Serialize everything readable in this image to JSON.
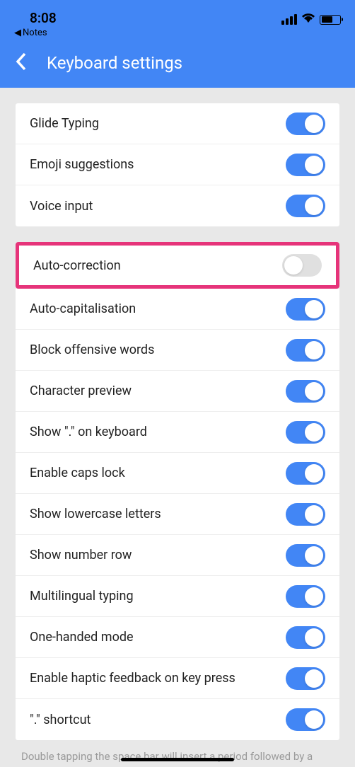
{
  "status": {
    "time": "8:08",
    "backApp": "Notes"
  },
  "header": {
    "title": "Keyboard settings"
  },
  "section1": [
    {
      "label": "Glide Typing",
      "on": true
    },
    {
      "label": "Emoji suggestions",
      "on": true
    },
    {
      "label": "Voice input",
      "on": true
    }
  ],
  "highlighted": {
    "label": "Auto-correction",
    "on": false
  },
  "section2": [
    {
      "label": "Auto-capitalisation",
      "on": true
    },
    {
      "label": "Block offensive words",
      "on": true
    },
    {
      "label": "Character preview",
      "on": true
    },
    {
      "label": "Show \".\" on keyboard",
      "on": true
    },
    {
      "label": "Enable caps lock",
      "on": true
    },
    {
      "label": "Show lowercase letters",
      "on": true
    },
    {
      "label": "Show number row",
      "on": true
    },
    {
      "label": "Multilingual typing",
      "on": true
    },
    {
      "label": "One-handed mode",
      "on": true
    },
    {
      "label": "Enable haptic feedback on key press",
      "on": true
    },
    {
      "label": "\".\" shortcut",
      "on": true
    }
  ],
  "footer": "Double tapping the space bar will insert a period followed by a"
}
